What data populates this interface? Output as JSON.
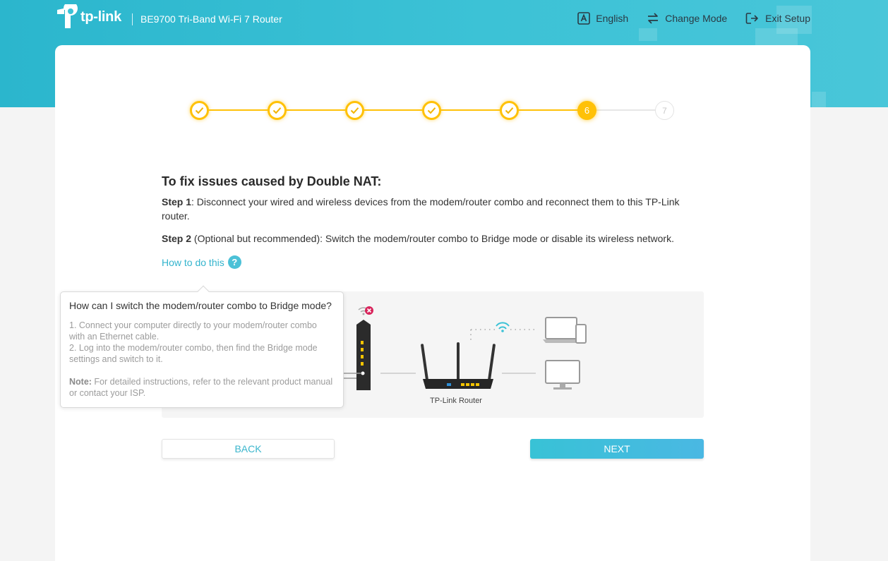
{
  "header": {
    "brand": "tp-link",
    "product": "BE9700 Tri-Band Wi-Fi 7 Router",
    "actions": [
      {
        "label": "English",
        "icon": "language-icon"
      },
      {
        "label": "Change Mode",
        "icon": "change-mode-icon"
      },
      {
        "label": "Exit Setup",
        "icon": "exit-icon"
      }
    ]
  },
  "stepper": {
    "steps": [
      {
        "label": "",
        "state": "done"
      },
      {
        "label": "",
        "state": "done"
      },
      {
        "label": "",
        "state": "done"
      },
      {
        "label": "",
        "state": "done"
      },
      {
        "label": "",
        "state": "done"
      },
      {
        "label": "6",
        "state": "current"
      },
      {
        "label": "7",
        "state": "pending"
      }
    ],
    "active_color": "#ffc107"
  },
  "content": {
    "heading": "To fix issues caused by Double NAT:",
    "step1_label": "Step 1",
    "step1_text": ": Disconnect your wired and wireless devices from the modem/router combo and reconnect them to this TP-Link router.",
    "step2_label": "Step 2",
    "step2_text": " (Optional but recommended): Switch the modem/router combo to Bridge mode or disable its wireless network.",
    "how_to_link": "How to do this",
    "how_to_icon": "?"
  },
  "diagram": {
    "router_label": "TP-Link Router"
  },
  "tooltip": {
    "title": "How can I switch the modem/router combo to Bridge mode?",
    "line1": "1. Connect your computer directly to your modem/router combo with an Ethernet cable.",
    "line2": "2. Log into the modem/router combo, then find the Bridge mode settings and switch to it.",
    "note_label": "Note:",
    "note_text": " For detailed instructions, refer to the relevant product manual or contact your ISP."
  },
  "buttons": {
    "back": "BACK",
    "next": "NEXT"
  },
  "colors": {
    "brand_teal": "#3cc2d6",
    "accent_yellow": "#ffc107",
    "link": "#33b4cd"
  }
}
